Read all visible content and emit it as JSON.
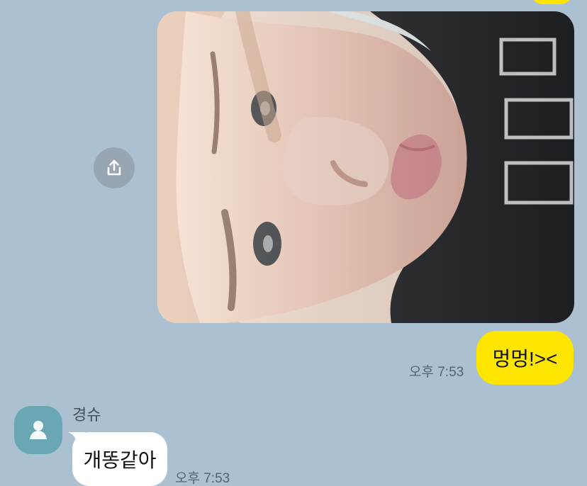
{
  "chat": {
    "messages": [
      {
        "direction": "outgoing",
        "type": "photo",
        "share_icon": "share-upload-icon"
      },
      {
        "direction": "outgoing",
        "text": "멍멍!><",
        "time": "오후 7:53",
        "bubble_color": "#fee500"
      },
      {
        "direction": "incoming",
        "sender": "경슈",
        "avatar_icon": "default-person-icon",
        "text": "개똥같아",
        "time": "오후 7:53",
        "bubble_color": "#ffffff"
      }
    ]
  },
  "colors": {
    "background": "#abc1d1",
    "outgoing_bubble": "#fee500",
    "incoming_bubble": "#ffffff",
    "avatar": "#6aa7b5"
  }
}
